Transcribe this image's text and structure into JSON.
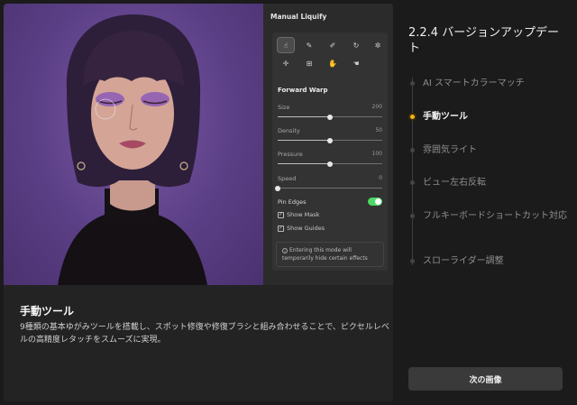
{
  "panel": {
    "title": "Manual Liquify",
    "section_title": "Forward Warp",
    "sliders": [
      {
        "label": "Size",
        "value": "200",
        "fraction": 0.5
      },
      {
        "label": "Density",
        "value": "50",
        "fraction": 0.5
      },
      {
        "label": "Pressure",
        "value": "100",
        "fraction": 0.5
      },
      {
        "label": "Speed",
        "value": "0",
        "fraction": 0.0
      }
    ],
    "pin_edges_label": "Pin Edges",
    "pin_edges_on": true,
    "show_mask_label": "Show Mask",
    "show_guides_label": "Show Guides",
    "info_text": "Entering this mode will temporarily hide certain effects",
    "tool_icons": [
      "warp-brush-icon",
      "reconstruct-icon",
      "smooth-icon",
      "twirl-icon",
      "pucker-icon",
      "bloat-icon",
      "push-left-icon",
      "freeze-icon",
      "thaw-icon"
    ]
  },
  "caption": {
    "title": "手動ツール",
    "body": "9種類の基本ゆがみツールを搭載し、スポット修復や修復ブラシと組み合わせることで、ピクセルレベルの高精度レタッチをスムーズに実現。"
  },
  "sidebar": {
    "title": "2.2.4 バージョンアップデート",
    "steps": [
      {
        "label": "AI スマートカラーマッチ",
        "active": false
      },
      {
        "label": "手動ツール",
        "active": true
      },
      {
        "label": "雰囲気ライト",
        "active": false
      },
      {
        "label": "ビュー左右反転",
        "active": false
      },
      {
        "label": "フルキーボードショートカット対応",
        "active": false
      },
      {
        "label": "スローライダー調整",
        "active": false
      }
    ],
    "next_button": "次の画像"
  },
  "colors": {
    "accent": "#f5b21a",
    "toggle_on": "#4cd964",
    "photo_background": "#5b3f86"
  }
}
